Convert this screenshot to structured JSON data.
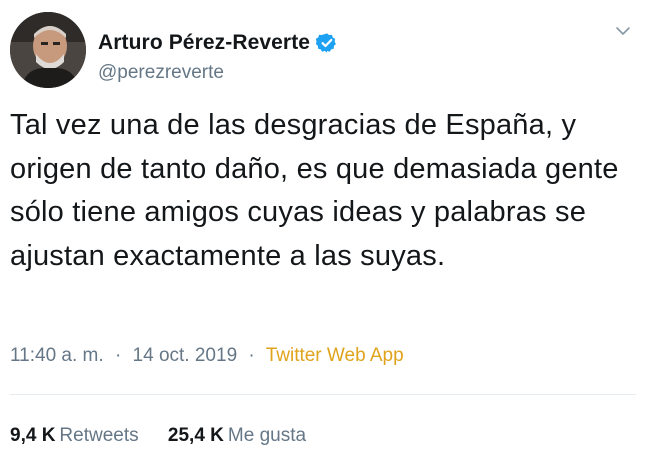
{
  "author": {
    "display_name": "Arturo Pérez-Reverte",
    "handle": "@perezreverte",
    "verified": true,
    "verified_color": "#1da1f2"
  },
  "tweet": {
    "text": "Tal vez una de las desgracias de España, y origen de tanto daño, es que demasiada gente sólo tiene amigos cuyas ideas y palabras se ajustan exactamente a las suyas."
  },
  "meta": {
    "time": "11:40 a. m.",
    "separator": "·",
    "date": "14 oct. 2019",
    "source": "Twitter Web App"
  },
  "stats": {
    "retweets_count": "9,4 K",
    "retweets_label": "Retweets",
    "likes_count": "25,4 K",
    "likes_label": "Me gusta"
  },
  "icons": {
    "verified": "verified-badge-icon",
    "more": "chevron-down-icon"
  }
}
